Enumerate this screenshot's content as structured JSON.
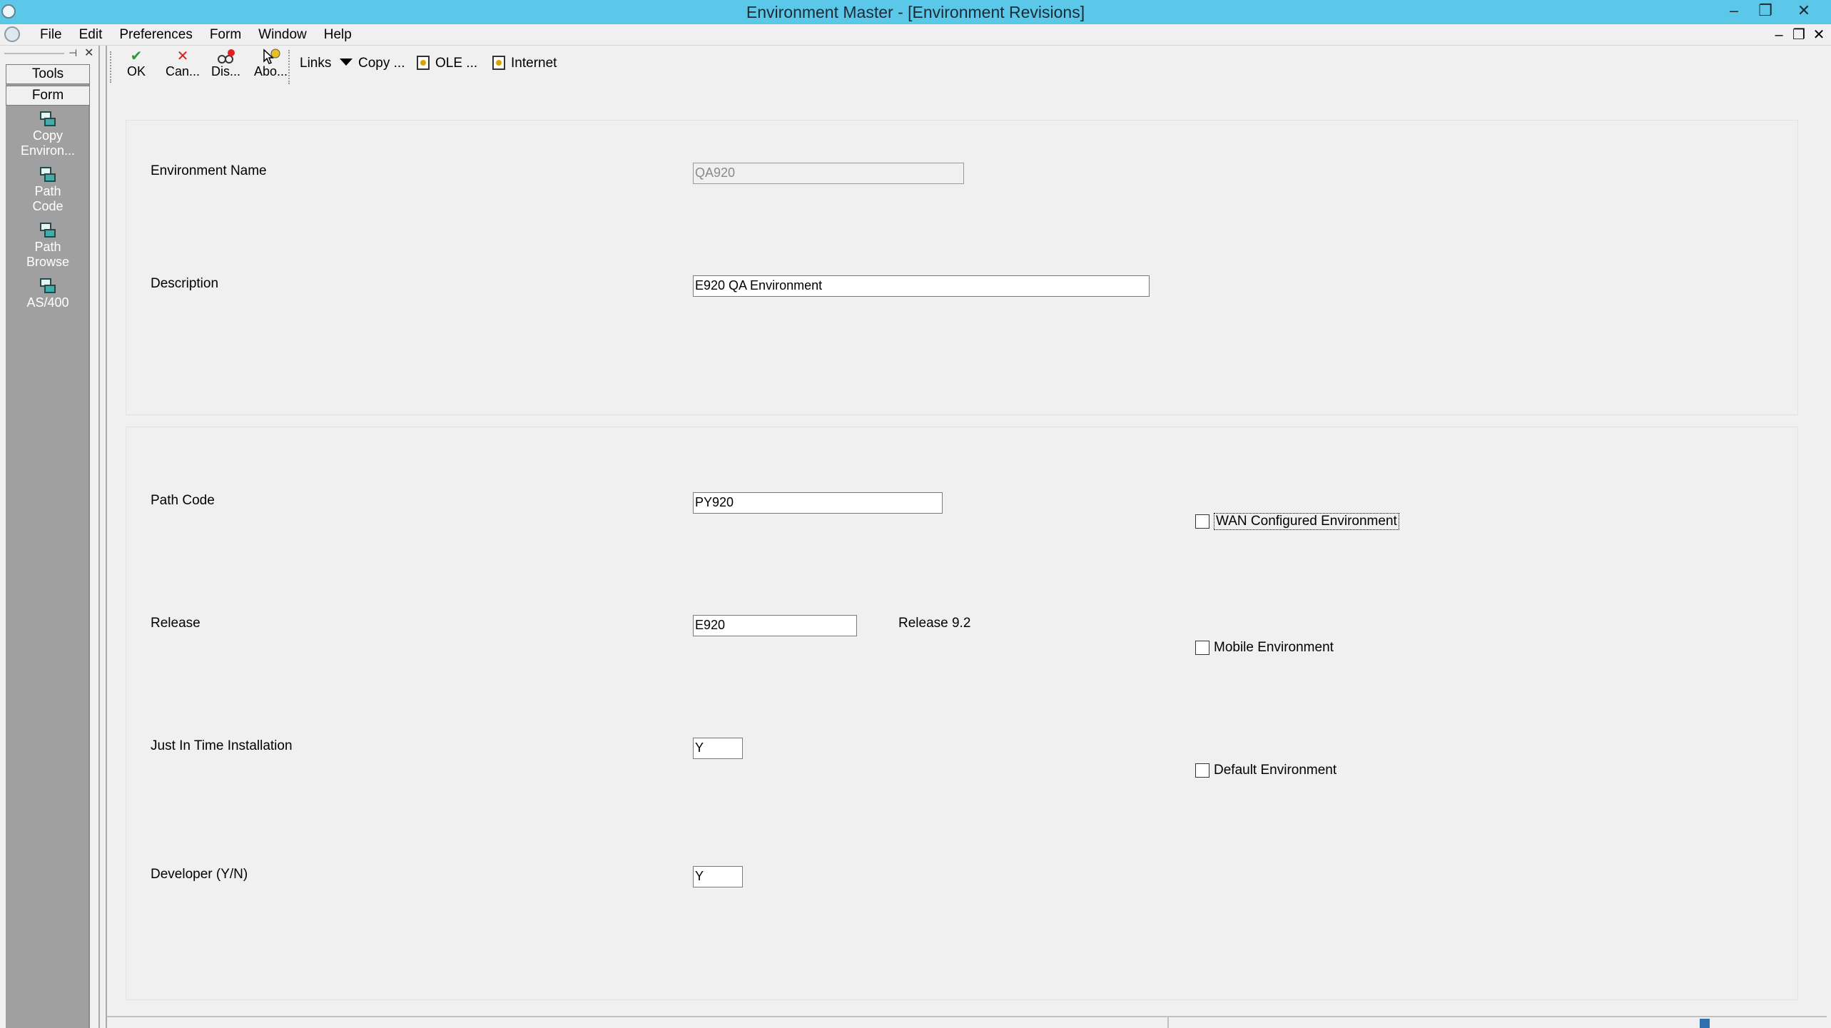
{
  "window": {
    "title": "Environment Master - [Environment Revisions]",
    "minimize_glyph": "–",
    "restore_glyph": "❐",
    "close_glyph": "✕"
  },
  "menubar": {
    "items": [
      "File",
      "Edit",
      "Preferences",
      "Form",
      "Window",
      "Help"
    ],
    "mdi_min": "–",
    "mdi_restore": "❐",
    "mdi_close": "✕"
  },
  "sidebar": {
    "tabs": [
      "Tools",
      "Form"
    ],
    "exits": [
      {
        "line1": "Copy",
        "line2": "Environ..."
      },
      {
        "line1": "Path",
        "line2": "Code"
      },
      {
        "line1": "Path",
        "line2": "Browse"
      },
      {
        "line1": "AS/400",
        "line2": ""
      }
    ]
  },
  "toolbar": {
    "ok": "OK",
    "cancel": "Can...",
    "display": "Dis...",
    "about": "Abo...",
    "links": "Links",
    "copy": "Copy ...",
    "ole": "OLE ...",
    "internet": "Internet"
  },
  "form": {
    "environment_name": {
      "label": "Environment Name",
      "value": "QA920"
    },
    "description": {
      "label": "Description",
      "value": "E920 QA Environment"
    },
    "path_code": {
      "label": "Path Code",
      "value": "PY920"
    },
    "release": {
      "label": "Release",
      "value": "E920",
      "description": "Release 9.2"
    },
    "jit_install": {
      "label": "Just In Time Installation",
      "value": "Y"
    },
    "developer": {
      "label": "Developer (Y/N)",
      "value": "Y"
    },
    "checkboxes": {
      "wan": {
        "label": "WAN Configured Environment",
        "checked": false
      },
      "mobile": {
        "label": "Mobile Environment",
        "checked": false
      },
      "default": {
        "label": "Default Environment",
        "checked": false
      }
    }
  },
  "colors": {
    "titlebar": "#5bc8ea",
    "sidebar": "#a0a0a0",
    "ok_check": "#2e9a3a",
    "cancel_x": "#d62020"
  }
}
